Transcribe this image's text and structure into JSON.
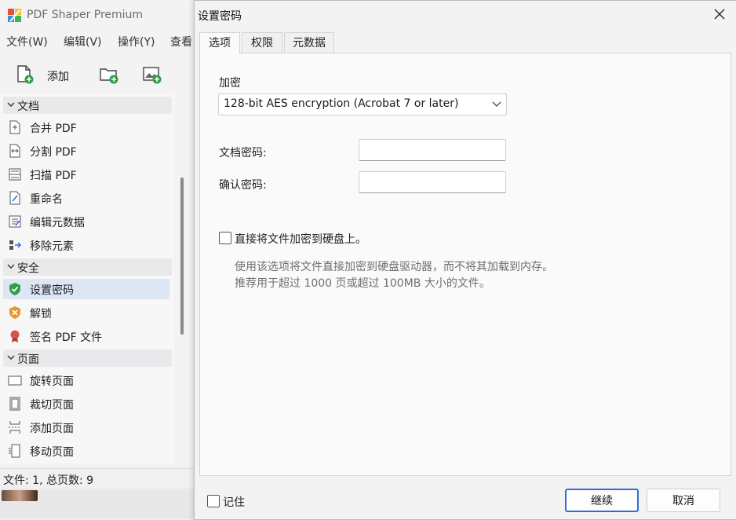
{
  "main_window": {
    "title": "PDF Shaper Premium",
    "menu": [
      "文件(W)",
      "编辑(V)",
      "操作(Y)",
      "查看"
    ],
    "toolbar": {
      "add_label": "添加"
    },
    "sidebar": {
      "sections": [
        {
          "label": "文档",
          "items": [
            "合并 PDF",
            "分割 PDF",
            "扫描 PDF",
            "重命名",
            "编辑元数据",
            "移除元素"
          ]
        },
        {
          "label": "安全",
          "items": [
            "设置密码",
            "解锁",
            "签名 PDF 文件"
          ]
        },
        {
          "label": "页面",
          "items": [
            "旋转页面",
            "裁切页面",
            "添加页面",
            "移动页面"
          ]
        }
      ],
      "selected": "设置密码"
    },
    "status": "文件: 1, 总页数: 9"
  },
  "dialog": {
    "title": "设置密码",
    "tabs": [
      "选项",
      "权限",
      "元数据"
    ],
    "active_tab": "选项",
    "encryption_label": "加密",
    "encryption_value": "128-bit AES encryption (Acrobat 7 or later)",
    "doc_password_label": "文档密码:",
    "confirm_password_label": "确认密码:",
    "doc_password_value": "",
    "confirm_password_value": "",
    "direct_encrypt_label": "直接将文件加密到硬盘上。",
    "direct_encrypt_checked": false,
    "hint_line1": "使用该选项将文件直接加密到硬盘驱动器，而不将其加载到内存。",
    "hint_line2": "推荐用于超过 1000 页或超过 100MB 大小的文件。",
    "remember_label": "记住",
    "remember_checked": false,
    "continue_label": "继续",
    "cancel_label": "取消"
  },
  "colors": {
    "accent": "#2b6fd6",
    "selected_bg": "#dce6f4",
    "security_green": "#2e9e48",
    "unlock_orange": "#e8962e",
    "sign_red": "#d9534f"
  },
  "icons": [
    "app-logo-icon",
    "add-file-icon",
    "add-folder-icon",
    "add-image-icon",
    "chevron-down-icon",
    "merge-icon",
    "split-icon",
    "scan-icon",
    "rename-icon",
    "metadata-icon",
    "remove-elements-icon",
    "shield-icon",
    "unlock-icon",
    "sign-icon",
    "rotate-page-icon",
    "crop-page-icon",
    "add-page-icon",
    "move-page-icon",
    "close-icon"
  ]
}
